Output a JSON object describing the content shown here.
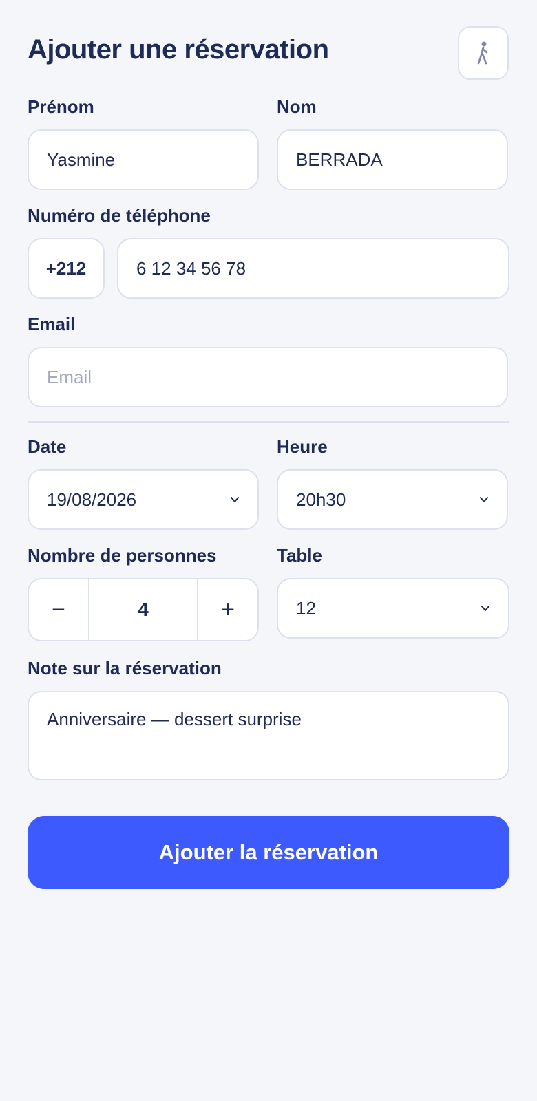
{
  "header": {
    "title": "Ajouter une réservation",
    "icon": "walking-person-icon"
  },
  "form": {
    "first_name": {
      "label": "Prénom",
      "value": "Yasmine"
    },
    "last_name": {
      "label": "Nom",
      "value": "BERRADA"
    },
    "phone": {
      "label": "Numéro de téléphone",
      "country_code": "+212",
      "number": "6 12 34 56 78"
    },
    "email": {
      "label": "Email",
      "placeholder": "Email",
      "value": ""
    },
    "date": {
      "label": "Date",
      "value": "19/08/2026"
    },
    "time": {
      "label": "Heure",
      "value": "20h30"
    },
    "guests": {
      "label": "Nombre de personnes",
      "value": "4",
      "minus": "−",
      "plus": "+"
    },
    "table": {
      "label": "Table",
      "value": "12"
    },
    "note": {
      "label": "Note sur la réservation",
      "value": "Anniversaire — dessert surprise"
    },
    "submit_label": "Ajouter la réservation"
  },
  "colors": {
    "primary": "#3d5afe",
    "text": "#1f2a55",
    "border": "#dde1ee",
    "background": "#f4f6fa"
  }
}
